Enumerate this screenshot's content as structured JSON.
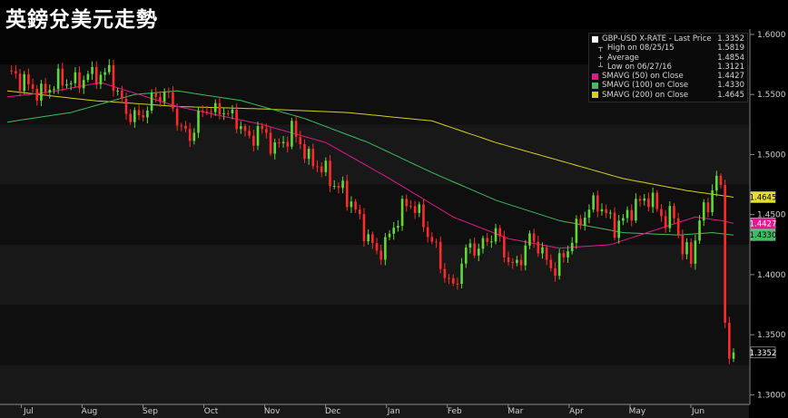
{
  "page_title": "英鎊兌美元走勢",
  "legend": {
    "header": {
      "label": "GBP-USD X-RATE - Last Price",
      "value": "1.3352"
    },
    "rows": [
      {
        "label": "High on 08/25/15",
        "value": "1.5819",
        "icon": "high-marker-icon"
      },
      {
        "label": "Average",
        "value": "1.4854",
        "icon": "average-marker-icon"
      },
      {
        "label": "Low on 06/27/16",
        "value": "1.3121",
        "icon": "low-marker-icon"
      },
      {
        "label": "SMAVG (50) on Close",
        "value": "1.4427",
        "color": "#e0198f"
      },
      {
        "label": "SMAVG (100) on Close",
        "value": "1.4330",
        "color": "#3dbd60"
      },
      {
        "label": "SMAVG (200) on Close",
        "value": "1.4645",
        "color": "#d6cf22"
      }
    ]
  },
  "chart_data": {
    "type": "candlestick",
    "x_axis": {
      "labels": [
        "Jul",
        "Aug",
        "Sep",
        "Oct",
        "Nov",
        "Dec",
        "Jan",
        "Feb",
        "Mar",
        "Apr",
        "May",
        "Jun"
      ]
    },
    "y_axis": {
      "ticks": [
        "1.6000",
        "1.5500",
        "1.5000",
        "1.4500",
        "1.4000",
        "1.3500",
        "1.3000"
      ],
      "range": [
        1.2935,
        1.6045
      ],
      "side": "right"
    },
    "price_tags": [
      {
        "value": 1.4645,
        "label": "1.4645",
        "bg": "#e6df2a",
        "fg": "#000000"
      },
      {
        "value": 1.4427,
        "label": "1.4427",
        "bg": "#e0198f",
        "fg": "#ffffff"
      },
      {
        "value": 1.433,
        "label": "1.4330",
        "bg": "#3dbd60",
        "fg": "#000000"
      },
      {
        "value": 1.3352,
        "label": "1.3352",
        "bg": "#000000",
        "fg": "#ffffff"
      }
    ],
    "colors": {
      "up": "#5fd93a",
      "down": "#ff2a2a",
      "sma50": "#e0198f",
      "sma100": "#3dbd60",
      "sma200": "#d6cf22"
    },
    "close_keypoints": [
      [
        0,
        1.57
      ],
      [
        4,
        1.56
      ],
      [
        8,
        1.55
      ],
      [
        12,
        1.562
      ],
      [
        16,
        1.56
      ],
      [
        20,
        1.567
      ],
      [
        23,
        1.565
      ],
      [
        24,
        1.572
      ],
      [
        26,
        1.55
      ],
      [
        28,
        1.535
      ],
      [
        31,
        1.53
      ],
      [
        34,
        1.545
      ],
      [
        37,
        1.552
      ],
      [
        39,
        1.54
      ],
      [
        41,
        1.52
      ],
      [
        43,
        1.515
      ],
      [
        45,
        1.53
      ],
      [
        47,
        1.54
      ],
      [
        49,
        1.535
      ],
      [
        51,
        1.538
      ],
      [
        53,
        1.53
      ],
      [
        55,
        1.525
      ],
      [
        57,
        1.51
      ],
      [
        59,
        1.522
      ],
      [
        61,
        1.515
      ],
      [
        63,
        1.505
      ],
      [
        65,
        1.51
      ],
      [
        67,
        1.52
      ],
      [
        69,
        1.51
      ],
      [
        71,
        1.495
      ],
      [
        73,
        1.492
      ],
      [
        75,
        1.485
      ],
      [
        77,
        1.475
      ],
      [
        79,
        1.47
      ],
      [
        81,
        1.46
      ],
      [
        83,
        1.445
      ],
      [
        85,
        1.43
      ],
      [
        87,
        1.418
      ],
      [
        89,
        1.425
      ],
      [
        91,
        1.44
      ],
      [
        93,
        1.455
      ],
      [
        95,
        1.46
      ],
      [
        97,
        1.45
      ],
      [
        99,
        1.435
      ],
      [
        101,
        1.42
      ],
      [
        103,
        1.4
      ],
      [
        105,
        1.388
      ],
      [
        107,
        1.41
      ],
      [
        109,
        1.425
      ],
      [
        111,
        1.42
      ],
      [
        113,
        1.43
      ],
      [
        115,
        1.435
      ],
      [
        117,
        1.42
      ],
      [
        119,
        1.405
      ],
      [
        121,
        1.415
      ],
      [
        123,
        1.43
      ],
      [
        125,
        1.425
      ],
      [
        127,
        1.41
      ],
      [
        129,
        1.405
      ],
      [
        131,
        1.415
      ],
      [
        133,
        1.43
      ],
      [
        135,
        1.445
      ],
      [
        137,
        1.455
      ],
      [
        139,
        1.46
      ],
      [
        141,
        1.45
      ],
      [
        143,
        1.44
      ],
      [
        145,
        1.445
      ],
      [
        147,
        1.455
      ],
      [
        149,
        1.46
      ],
      [
        151,
        1.465
      ],
      [
        153,
        1.455
      ],
      [
        155,
        1.445
      ],
      [
        157,
        1.45
      ],
      [
        159,
        1.42
      ],
      [
        161,
        1.415
      ],
      [
        163,
        1.445
      ],
      [
        165,
        1.46
      ],
      [
        167,
        1.48
      ],
      [
        168,
        1.47
      ],
      [
        169,
        1.36
      ],
      [
        170,
        1.33
      ],
      [
        171,
        1.3352
      ]
    ],
    "sma50_keypoints": [
      [
        0,
        1.548
      ],
      [
        10,
        1.552
      ],
      [
        22,
        1.56
      ],
      [
        40,
        1.54
      ],
      [
        60,
        1.525
      ],
      [
        75,
        1.51
      ],
      [
        90,
        1.48
      ],
      [
        105,
        1.448
      ],
      [
        118,
        1.43
      ],
      [
        130,
        1.422
      ],
      [
        142,
        1.425
      ],
      [
        155,
        1.44
      ],
      [
        162,
        1.448
      ],
      [
        168,
        1.445
      ],
      [
        171,
        1.4427
      ]
    ],
    "sma100_keypoints": [
      [
        0,
        1.527
      ],
      [
        15,
        1.535
      ],
      [
        30,
        1.55
      ],
      [
        40,
        1.553
      ],
      [
        55,
        1.545
      ],
      [
        70,
        1.53
      ],
      [
        85,
        1.51
      ],
      [
        100,
        1.485
      ],
      [
        115,
        1.462
      ],
      [
        130,
        1.445
      ],
      [
        145,
        1.435
      ],
      [
        158,
        1.433
      ],
      [
        166,
        1.435
      ],
      [
        171,
        1.433
      ]
    ],
    "sma200_keypoints": [
      [
        0,
        1.553
      ],
      [
        20,
        1.545
      ],
      [
        40,
        1.54
      ],
      [
        60,
        1.538
      ],
      [
        80,
        1.535
      ],
      [
        100,
        1.528
      ],
      [
        115,
        1.51
      ],
      [
        130,
        1.495
      ],
      [
        145,
        1.48
      ],
      [
        160,
        1.47
      ],
      [
        171,
        1.4645
      ]
    ]
  }
}
